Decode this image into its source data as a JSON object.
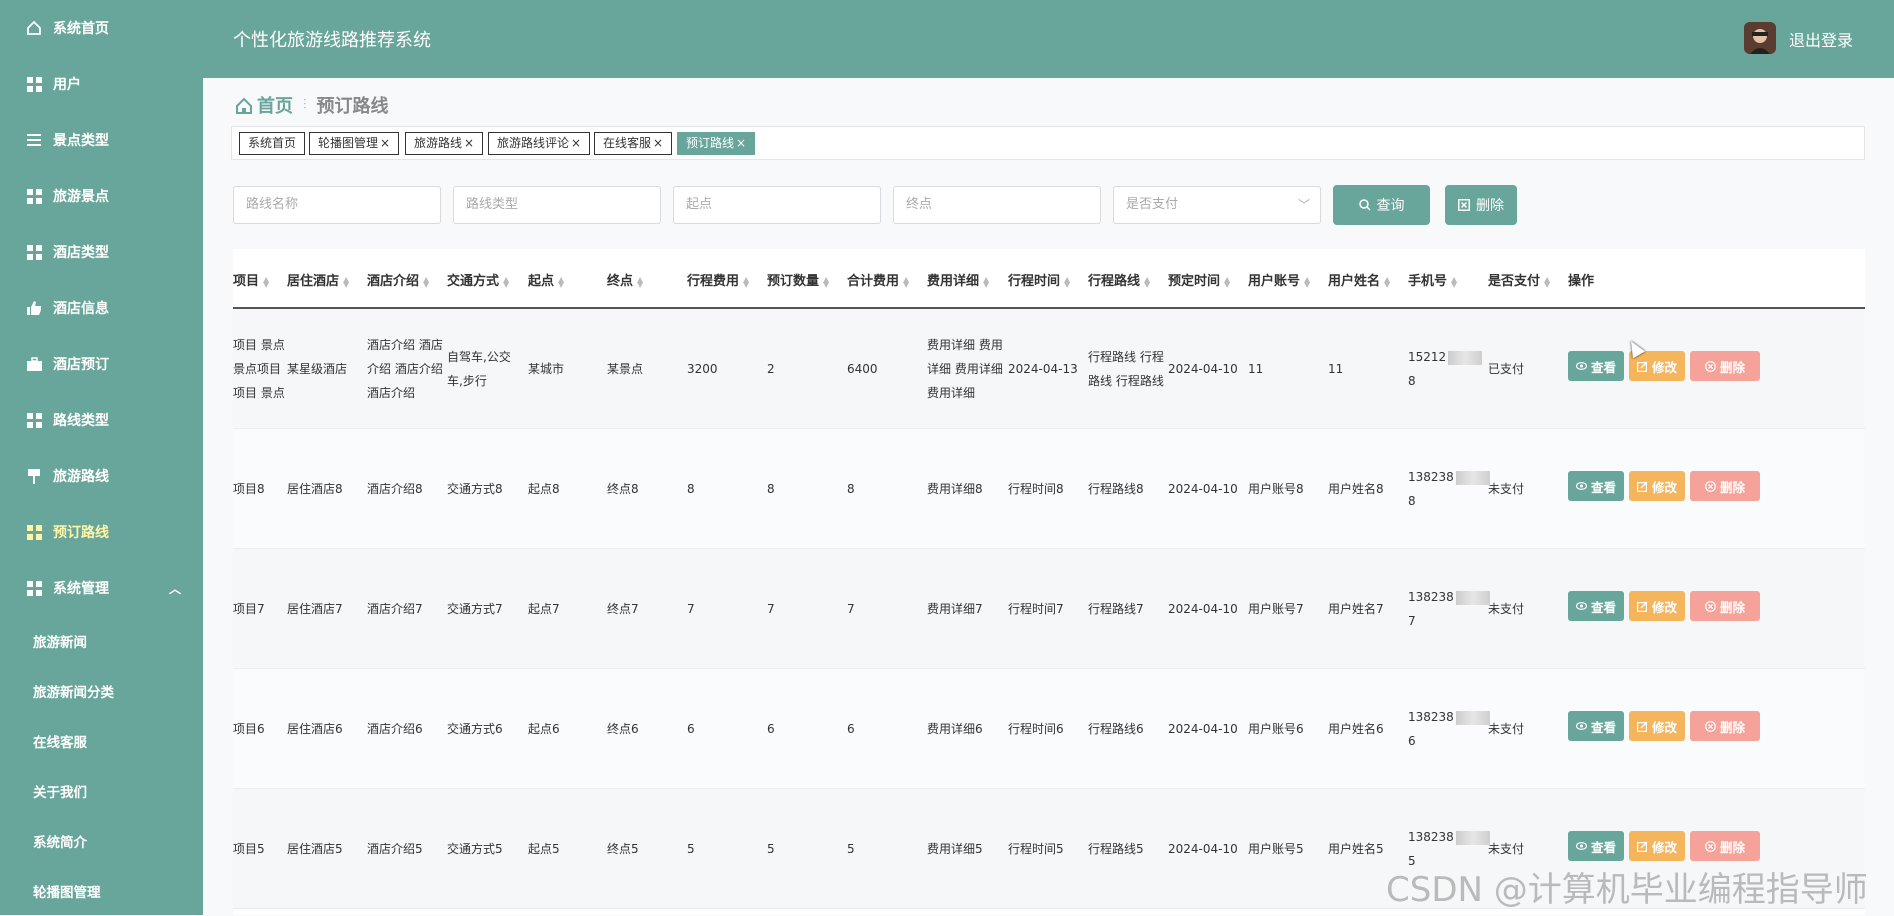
{
  "sidebar": {
    "items": [
      {
        "label": "系统首页",
        "icon": "home-icon"
      },
      {
        "label": "用户",
        "icon": "grid-icon"
      },
      {
        "label": "景点类型",
        "icon": "list-icon"
      },
      {
        "label": "旅游景点",
        "icon": "grid-icon"
      },
      {
        "label": "酒店类型",
        "icon": "grid-icon"
      },
      {
        "label": "酒店信息",
        "icon": "thumb-icon"
      },
      {
        "label": "酒店预订",
        "icon": "briefcase-icon"
      },
      {
        "label": "路线类型",
        "icon": "grid-icon"
      },
      {
        "label": "旅游路线",
        "icon": "pin-icon"
      },
      {
        "label": "预订路线",
        "icon": "grid-icon"
      },
      {
        "label": "系统管理",
        "icon": "grid-icon"
      }
    ],
    "subitems": [
      "旅游新闻",
      "旅游新闻分类",
      "在线客服",
      "关于我们",
      "系统简介",
      "轮播图管理"
    ]
  },
  "header": {
    "title": "个性化旅游线路推荐系统",
    "logout": "退出登录"
  },
  "breadcrumb": {
    "home": "首页",
    "current": "预订路线"
  },
  "tags": [
    "系统首页",
    "轮播图管理",
    "旅游路线",
    "旅游路线评论",
    "在线客服",
    "预订路线"
  ],
  "tag_close": "×",
  "search": {
    "route_name": "路线名称",
    "route_type": "路线类型",
    "start": "起点",
    "end": "终点",
    "paid": "是否支付",
    "query_btn": "查询",
    "delete_btn": "删除"
  },
  "table": {
    "headers": [
      "项目",
      "居住酒店",
      "酒店介绍",
      "交通方式",
      "起点",
      "终点",
      "行程费用",
      "预订数量",
      "合计费用",
      "费用详细",
      "行程时间",
      "行程路线",
      "预定时间",
      "用户账号",
      "用户姓名",
      "手机号",
      "是否支付",
      "操作"
    ],
    "rows": [
      {
        "project": [
          "项目 景点",
          "景点项目",
          "项目 景点"
        ],
        "hotel": "某星级酒店",
        "intro": [
          "酒店介绍 酒店",
          "介绍 酒店介绍",
          "酒店介绍"
        ],
        "transport": [
          "自驾车,公交",
          "车,步行"
        ],
        "start": "某城市",
        "end": "某景点",
        "cost": "3200",
        "qty": "2",
        "total": "6400",
        "detail": [
          "费用详细 费用",
          "详细 费用详细",
          "费用详细"
        ],
        "time": "2024-04-13",
        "route": [
          "行程路线 行程",
          "路线 行程路线"
        ],
        "booked": "2024-04-10",
        "account": "11",
        "username": "11",
        "phone1": "15212",
        "phone2": "8",
        "paid": "已支付"
      },
      {
        "project": [
          "项目8"
        ],
        "hotel": "居住酒店8",
        "intro": [
          "酒店介绍8"
        ],
        "transport": [
          "交通方式8"
        ],
        "start": "起点8",
        "end": "终点8",
        "cost": "8",
        "qty": "8",
        "total": "8",
        "detail": [
          "费用详细8"
        ],
        "time": "行程时间8",
        "route": [
          "行程路线8"
        ],
        "booked": "2024-04-10",
        "account": "用户账号8",
        "username": "用户姓名8",
        "phone1": "138238",
        "phone2": "8",
        "paid": "未支付"
      },
      {
        "project": [
          "项目7"
        ],
        "hotel": "居住酒店7",
        "intro": [
          "酒店介绍7"
        ],
        "transport": [
          "交通方式7"
        ],
        "start": "起点7",
        "end": "终点7",
        "cost": "7",
        "qty": "7",
        "total": "7",
        "detail": [
          "费用详细7"
        ],
        "time": "行程时间7",
        "route": [
          "行程路线7"
        ],
        "booked": "2024-04-10",
        "account": "用户账号7",
        "username": "用户姓名7",
        "phone1": "138238",
        "phone2": "7",
        "paid": "未支付"
      },
      {
        "project": [
          "项目6"
        ],
        "hotel": "居住酒店6",
        "intro": [
          "酒店介绍6"
        ],
        "transport": [
          "交通方式6"
        ],
        "start": "起点6",
        "end": "终点6",
        "cost": "6",
        "qty": "6",
        "total": "6",
        "detail": [
          "费用详细6"
        ],
        "time": "行程时间6",
        "route": [
          "行程路线6"
        ],
        "booked": "2024-04-10",
        "account": "用户账号6",
        "username": "用户姓名6",
        "phone1": "138238",
        "phone2": "6",
        "paid": "未支付"
      },
      {
        "project": [
          "项目5"
        ],
        "hotel": "居住酒店5",
        "intro": [
          "酒店介绍5"
        ],
        "transport": [
          "交通方式5"
        ],
        "start": "起点5",
        "end": "终点5",
        "cost": "5",
        "qty": "5",
        "total": "5",
        "detail": [
          "费用详细5"
        ],
        "time": "行程时间5",
        "route": [
          "行程路线5"
        ],
        "booked": "2024-04-10",
        "account": "用户账号5",
        "username": "用户姓名5",
        "phone1": "138238",
        "phone2": "5",
        "paid": "未支付"
      }
    ],
    "row_actions": {
      "view": "查看",
      "edit": "修改",
      "delete": "删除"
    }
  },
  "watermark": "CSDN @计算机毕业编程指导师",
  "colors": {
    "primary": "#68a59b",
    "warning": "#f5b55c",
    "danger": "#f5a39a",
    "active_menu": "#fff5a6"
  }
}
